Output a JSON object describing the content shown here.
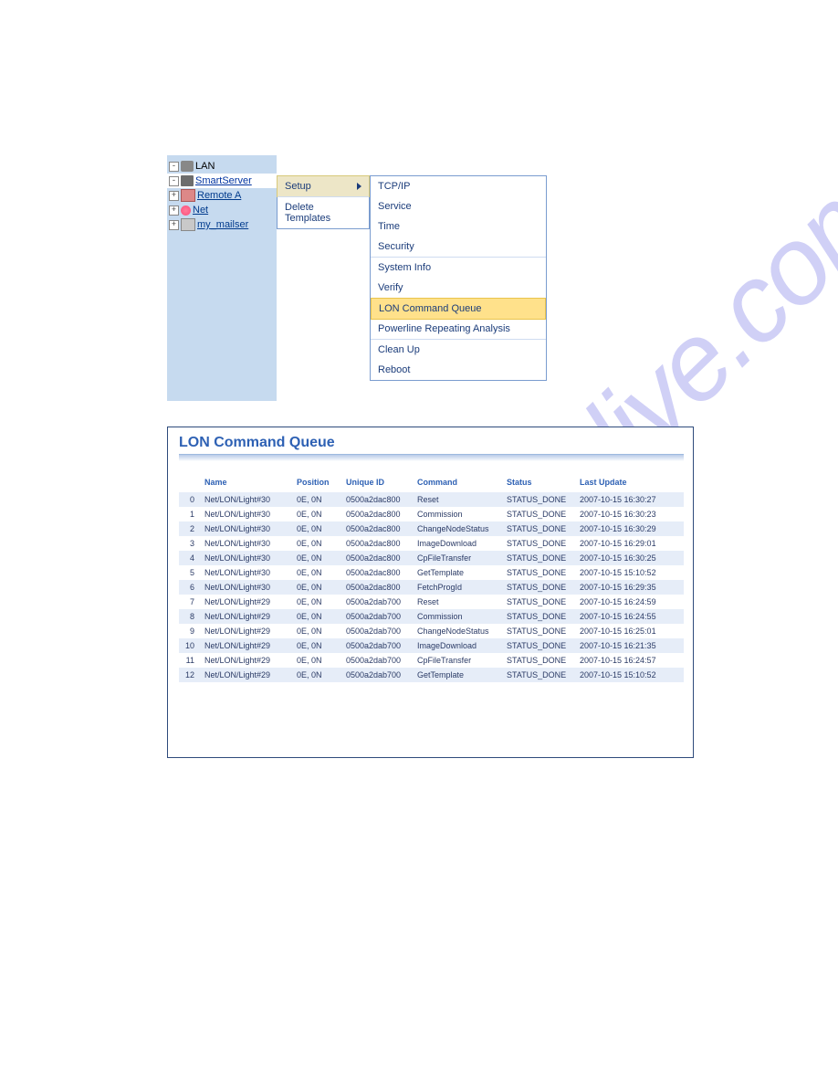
{
  "tree": {
    "root": {
      "label": "LAN"
    },
    "smartserver": {
      "label": "SmartServer"
    },
    "remote": {
      "label": "Remote A"
    },
    "net": {
      "label": "Net"
    },
    "mailserver": {
      "label": "my_mailser"
    }
  },
  "context_menu_1": {
    "setup": "Setup",
    "delete_templates": "Delete Templates"
  },
  "context_menu_2": {
    "tcpip": "TCP/IP",
    "service": "Service",
    "time": "Time",
    "security": "Security",
    "system_info": "System Info",
    "verify": "Verify",
    "lon_command_queue": "LON Command Queue",
    "powerline": "Powerline Repeating Analysis",
    "cleanup": "Clean Up",
    "reboot": "Reboot"
  },
  "queue": {
    "title": "LON Command Queue",
    "headers": {
      "idx": "",
      "name": "Name",
      "position": "Position",
      "unique_id": "Unique ID",
      "command": "Command",
      "status": "Status",
      "last_update": "Last Update"
    },
    "rows": [
      {
        "idx": "0",
        "name": "Net/LON/Light#30",
        "position": "0E, 0N",
        "uid": "0500a2dac800",
        "cmd": "Reset",
        "status": "STATUS_DONE",
        "ts": "2007-10-15 16:30:27"
      },
      {
        "idx": "1",
        "name": "Net/LON/Light#30",
        "position": "0E, 0N",
        "uid": "0500a2dac800",
        "cmd": "Commission",
        "status": "STATUS_DONE",
        "ts": "2007-10-15 16:30:23"
      },
      {
        "idx": "2",
        "name": "Net/LON/Light#30",
        "position": "0E, 0N",
        "uid": "0500a2dac800",
        "cmd": "ChangeNodeStatus",
        "status": "STATUS_DONE",
        "ts": "2007-10-15 16:30:29"
      },
      {
        "idx": "3",
        "name": "Net/LON/Light#30",
        "position": "0E, 0N",
        "uid": "0500a2dac800",
        "cmd": "ImageDownload",
        "status": "STATUS_DONE",
        "ts": "2007-10-15 16:29:01"
      },
      {
        "idx": "4",
        "name": "Net/LON/Light#30",
        "position": "0E, 0N",
        "uid": "0500a2dac800",
        "cmd": "CpFileTransfer",
        "status": "STATUS_DONE",
        "ts": "2007-10-15 16:30:25"
      },
      {
        "idx": "5",
        "name": "Net/LON/Light#30",
        "position": "0E, 0N",
        "uid": "0500a2dac800",
        "cmd": "GetTemplate",
        "status": "STATUS_DONE",
        "ts": "2007-10-15 15:10:52"
      },
      {
        "idx": "6",
        "name": "Net/LON/Light#30",
        "position": "0E, 0N",
        "uid": "0500a2dac800",
        "cmd": "FetchProgId",
        "status": "STATUS_DONE",
        "ts": "2007-10-15 16:29:35"
      },
      {
        "idx": "7",
        "name": "Net/LON/Light#29",
        "position": "0E, 0N",
        "uid": "0500a2dab700",
        "cmd": "Reset",
        "status": "STATUS_DONE",
        "ts": "2007-10-15 16:24:59"
      },
      {
        "idx": "8",
        "name": "Net/LON/Light#29",
        "position": "0E, 0N",
        "uid": "0500a2dab700",
        "cmd": "Commission",
        "status": "STATUS_DONE",
        "ts": "2007-10-15 16:24:55"
      },
      {
        "idx": "9",
        "name": "Net/LON/Light#29",
        "position": "0E, 0N",
        "uid": "0500a2dab700",
        "cmd": "ChangeNodeStatus",
        "status": "STATUS_DONE",
        "ts": "2007-10-15 16:25:01"
      },
      {
        "idx": "10",
        "name": "Net/LON/Light#29",
        "position": "0E, 0N",
        "uid": "0500a2dab700",
        "cmd": "ImageDownload",
        "status": "STATUS_DONE",
        "ts": "2007-10-15 16:21:35"
      },
      {
        "idx": "11",
        "name": "Net/LON/Light#29",
        "position": "0E, 0N",
        "uid": "0500a2dab700",
        "cmd": "CpFileTransfer",
        "status": "STATUS_DONE",
        "ts": "2007-10-15 16:24:57"
      },
      {
        "idx": "12",
        "name": "Net/LON/Light#29",
        "position": "0E, 0N",
        "uid": "0500a2dab700",
        "cmd": "GetTemplate",
        "status": "STATUS_DONE",
        "ts": "2007-10-15 15:10:52"
      }
    ]
  },
  "watermark": "manualslive.com"
}
